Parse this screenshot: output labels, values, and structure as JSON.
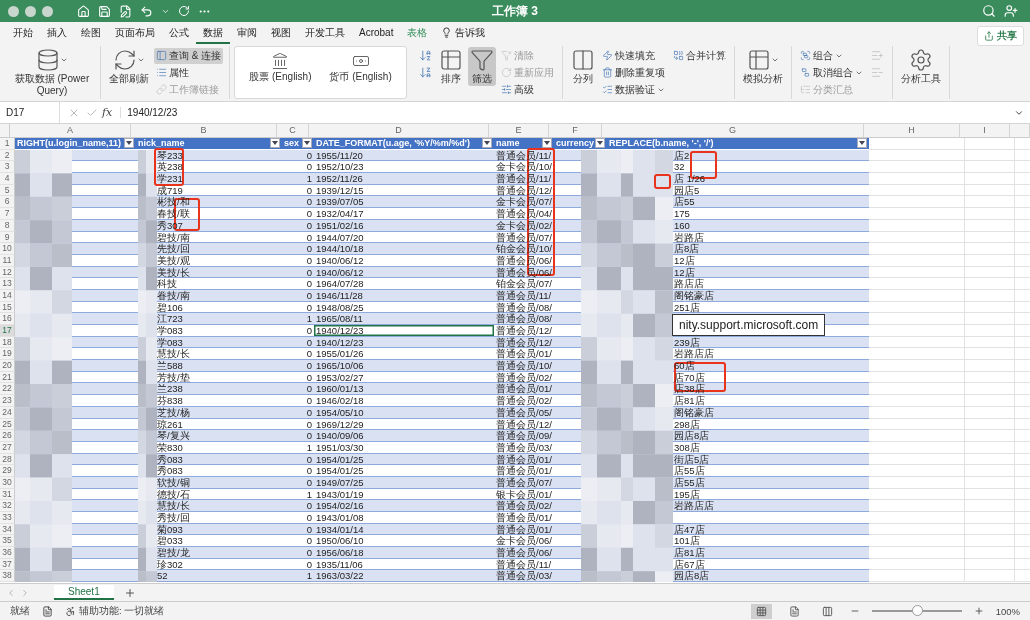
{
  "window": {
    "title": "工作簿 3"
  },
  "menu_tabs": [
    {
      "label": "开始",
      "kind": "tab",
      "selected": false
    },
    {
      "label": "插入",
      "kind": "tab",
      "selected": false
    },
    {
      "label": "绘图",
      "kind": "tab",
      "selected": false
    },
    {
      "label": "页面布局",
      "kind": "tab",
      "selected": false
    },
    {
      "label": "公式",
      "kind": "tab",
      "selected": false
    },
    {
      "label": "数据",
      "kind": "tab",
      "selected": true
    },
    {
      "label": "审阅",
      "kind": "tab",
      "selected": false
    },
    {
      "label": "视图",
      "kind": "tab",
      "selected": false
    },
    {
      "label": "开发工具",
      "kind": "tab",
      "selected": false
    },
    {
      "label": "Acrobat",
      "kind": "tab",
      "selected": false
    },
    {
      "label": "表格",
      "kind": "contextual",
      "selected": false
    },
    {
      "label": "告诉我",
      "kind": "tell-me",
      "selected": false
    }
  ],
  "share_button": "共享",
  "ribbon": [
    {
      "boxed": false,
      "items": [
        {
          "kind": "large",
          "label": "获取数据 (Power Query)",
          "menu": true,
          "active": false,
          "disabled": false
        }
      ]
    },
    {
      "boxed": false,
      "items": [
        {
          "kind": "large",
          "label": "全部刷新",
          "menu": true,
          "active": false,
          "disabled": false
        },
        {
          "kind": "small",
          "label": "查询 & 连接",
          "menu": false,
          "active": true,
          "disabled": false
        },
        {
          "kind": "small",
          "label": "属性",
          "menu": false,
          "active": false,
          "disabled": false
        },
        {
          "kind": "small",
          "label": "工作簿链接",
          "menu": false,
          "active": false,
          "disabled": true
        }
      ]
    },
    {
      "boxed": true,
      "items": [
        {
          "kind": "datatype",
          "label": "股票 (English)",
          "menu": false,
          "active": false,
          "disabled": false
        },
        {
          "kind": "datatype",
          "label": "货币 (English)",
          "menu": false,
          "active": false,
          "disabled": false
        }
      ]
    },
    {
      "boxed": false,
      "items": [
        {
          "kind": "icon",
          "disabled": false
        },
        {
          "kind": "icon",
          "disabled": false
        },
        {
          "kind": "large",
          "label": "排序",
          "menu": false,
          "active": false,
          "disabled": false
        },
        {
          "kind": "large",
          "label": "筛选",
          "menu": false,
          "active": true,
          "disabled": false
        },
        {
          "kind": "small",
          "label": "清除",
          "menu": false,
          "active": false,
          "disabled": true
        },
        {
          "kind": "small",
          "label": "重新应用",
          "menu": false,
          "active": false,
          "disabled": true
        },
        {
          "kind": "small",
          "label": "高级",
          "menu": false,
          "active": false,
          "disabled": false
        }
      ]
    },
    {
      "boxed": false,
      "items": [
        {
          "kind": "large",
          "label": "分列",
          "menu": false,
          "active": false,
          "disabled": false
        },
        {
          "kind": "small",
          "label": "快速填充",
          "menu": false,
          "active": false,
          "disabled": false
        },
        {
          "kind": "small",
          "label": "删除重复项",
          "menu": false,
          "active": false,
          "disabled": false
        },
        {
          "kind": "small",
          "label": "数据验证",
          "menu": true,
          "active": false,
          "disabled": false
        },
        {
          "kind": "small",
          "label": "合并计算",
          "menu": false,
          "active": false,
          "disabled": false
        }
      ]
    },
    {
      "boxed": false,
      "items": [
        {
          "kind": "large",
          "label": "模拟分析",
          "menu": true,
          "active": false,
          "disabled": false
        }
      ]
    },
    {
      "boxed": false,
      "items": [
        {
          "kind": "small",
          "label": "组合",
          "menu": true,
          "active": false,
          "disabled": false
        },
        {
          "kind": "small",
          "label": "取消组合",
          "menu": true,
          "active": false,
          "disabled": false
        },
        {
          "kind": "small",
          "label": "分类汇总",
          "menu": false,
          "active": false,
          "disabled": true
        },
        {
          "kind": "icon",
          "disabled": true
        },
        {
          "kind": "icon",
          "disabled": true
        }
      ]
    },
    {
      "boxed": false,
      "items": [
        {
          "kind": "large",
          "label": "分析工具",
          "menu": false,
          "active": false,
          "disabled": false
        }
      ]
    }
  ],
  "formula_bar": {
    "name_box": "D17",
    "fx": "fx",
    "formula": "1940/12/23"
  },
  "column_letters": [
    "A",
    "B",
    "C",
    "D",
    "E",
    "F",
    "G",
    "H",
    "I"
  ],
  "table": {
    "header_row_number": "1",
    "columns": [
      "RIGHT(u.login_name,11)",
      "nick_name",
      "sex",
      "DATE_FORMAT(u.age, '%Y/%m/%d')",
      "name",
      "currency",
      "REPLACE(b.name, '-', '/')"
    ],
    "rows": [
      {
        "n": "2",
        "nick": "琴233",
        "sex": "0",
        "date": "1955/11/20",
        "name": "普通会员/11/",
        "g": "店2",
        "selected": false
      },
      {
        "n": "3",
        "nick": "英238",
        "sex": "0",
        "date": "1952/10/23",
        "name": "金卡会员/10/",
        "g": "32",
        "selected": false
      },
      {
        "n": "4",
        "nick": "学231",
        "sex": "1",
        "date": "1952/11/26",
        "name": "普通会员/11/",
        "g": "店 1/26",
        "selected": false
      },
      {
        "n": "5",
        "nick": "成719",
        "sex": "0",
        "date": "1939/12/15",
        "name": "普通会员/12/",
        "g": "园店5",
        "selected": false
      },
      {
        "n": "6",
        "nick": "彬技/和",
        "sex": "0",
        "date": "1939/07/05",
        "name": "金卡会员/07/",
        "g": "店55",
        "selected": false
      },
      {
        "n": "7",
        "nick": "春技/联",
        "sex": "0",
        "date": "1932/04/17",
        "name": "普通会员/04/",
        "g": "175",
        "selected": false
      },
      {
        "n": "8",
        "nick": "秀307",
        "sex": "0",
        "date": "1951/02/16",
        "name": "金卡会员/02/",
        "g": "160",
        "selected": false
      },
      {
        "n": "9",
        "nick": "碧技/南",
        "sex": "0",
        "date": "1944/07/20",
        "name": "普通会员/07/",
        "g": "岩路店",
        "selected": false
      },
      {
        "n": "10",
        "nick": "先技/回",
        "sex": "0",
        "date": "1944/10/18",
        "name": "铂金会员/10/",
        "g": "店8店",
        "selected": false
      },
      {
        "n": "11",
        "nick": "美技/观",
        "sex": "0",
        "date": "1940/06/12",
        "name": "普通会员/06/",
        "g": "12店",
        "selected": false
      },
      {
        "n": "12",
        "nick": "美技/长",
        "sex": "0",
        "date": "1940/06/12",
        "name": "普通会员/06/",
        "g": "12店",
        "selected": false
      },
      {
        "n": "13",
        "nick": "科技",
        "sex": "0",
        "date": "1964/07/28",
        "name": "铂金会员/07/",
        "g": "路店店",
        "selected": false
      },
      {
        "n": "14",
        "nick": "眷技/南",
        "sex": "0",
        "date": "1946/11/28",
        "name": "普通会员/11/",
        "g": "阁铭豪店",
        "selected": false
      },
      {
        "n": "15",
        "nick": "碧106",
        "sex": "0",
        "date": "1948/08/25",
        "name": "普通会员/08/",
        "g": "251店",
        "selected": false
      },
      {
        "n": "16",
        "nick": "江723",
        "sex": "1",
        "date": "1965/08/11",
        "name": "普通会员/08/",
        "selected": false
      },
      {
        "n": "17",
        "nick": "学083",
        "sex": "0",
        "date": "1940/12/23",
        "name": "普通会员/12/",
        "selected": true
      },
      {
        "n": "18",
        "nick": "学083",
        "sex": "0",
        "date": "1940/12/23",
        "name": "普通会员/12/",
        "g": "239店",
        "selected": false
      },
      {
        "n": "19",
        "nick": "慧技/长",
        "sex": "0",
        "date": "1955/01/26",
        "name": "普通会员/01/",
        "g": "岩路店店",
        "selected": false
      },
      {
        "n": "20",
        "nick": "兰588",
        "sex": "0",
        "date": "1965/10/06",
        "name": "普通会员/10/",
        "g": "60店",
        "selected": false
      },
      {
        "n": "21",
        "nick": "芳技/垫",
        "sex": "0",
        "date": "1953/02/27",
        "name": "普通会员/02/",
        "g": "店70店",
        "selected": false
      },
      {
        "n": "22",
        "nick": "兰238",
        "sex": "0",
        "date": "1960/01/13",
        "name": "普通会员/01/",
        "g": "店38店",
        "selected": false
      },
      {
        "n": "23",
        "nick": "芬838",
        "sex": "0",
        "date": "1946/02/18",
        "name": "普通会员/02/",
        "g": "店81店",
        "selected": false
      },
      {
        "n": "24",
        "nick": "芝技/杨",
        "sex": "0",
        "date": "1954/05/10",
        "name": "普通会员/05/",
        "g": "阁铭豪店",
        "selected": false
      },
      {
        "n": "25",
        "nick": "琼261",
        "sex": "0",
        "date": "1969/12/29",
        "name": "普通会员/12/",
        "g": "298店",
        "selected": false
      },
      {
        "n": "26",
        "nick": "琴/复兴",
        "sex": "0",
        "date": "1940/09/06",
        "name": "普通会员/09/",
        "g": "园店8店",
        "selected": false
      },
      {
        "n": "27",
        "nick": "荣830",
        "sex": "1",
        "date": "1951/03/30",
        "name": "普通会员/03/",
        "g": "308店",
        "selected": false
      },
      {
        "n": "28",
        "nick": "秀083",
        "sex": "0",
        "date": "1954/01/25",
        "name": "普通会员/01/",
        "g": "街店5店",
        "selected": false
      },
      {
        "n": "29",
        "nick": "秀083",
        "sex": "0",
        "date": "1954/01/25",
        "name": "普通会员/01/",
        "g": "店55店",
        "selected": false
      },
      {
        "n": "30",
        "nick": "软技/铜",
        "sex": "0",
        "date": "1949/07/25",
        "name": "普通会员/07/",
        "g": "店55店",
        "selected": false
      },
      {
        "n": "31",
        "nick": "德技/石",
        "sex": "1",
        "date": "1943/01/19",
        "name": "银卡会员/01/",
        "g": "195店",
        "selected": false
      },
      {
        "n": "32",
        "nick": "慧技/长",
        "sex": "0",
        "date": "1954/02/16",
        "name": "普通会员/02/",
        "g": "岩路店店",
        "selected": false
      },
      {
        "n": "33",
        "nick": "秀技/回",
        "sex": "0",
        "date": "1943/01/08",
        "name": "普通会员/01/",
        "selected": false
      },
      {
        "n": "34",
        "nick": "菊093",
        "sex": "0",
        "date": "1934/01/14",
        "name": "普通会员/01/",
        "g": "店47店",
        "selected": false
      },
      {
        "n": "35",
        "nick": "碧033",
        "sex": "0",
        "date": "1950/06/10",
        "name": "金卡会员/06/",
        "g": "101店",
        "selected": false
      },
      {
        "n": "36",
        "nick": "碧技/龙",
        "sex": "0",
        "date": "1956/06/18",
        "name": "普通会员/06/",
        "g": "店81店",
        "selected": false
      },
      {
        "n": "37",
        "nick": "珍302",
        "sex": "0",
        "date": "1935/11/06",
        "name": "普通会员/11/",
        "g": "店67店",
        "selected": false
      },
      {
        "n": "38",
        "nick": "52",
        "sex": "1",
        "date": "1963/03/22",
        "name": "普通会员/03/",
        "g": "园店8店",
        "selected": false
      }
    ]
  },
  "tooltip": "nity.support.microsoft.com",
  "sheet_tabs": [
    {
      "label": "Sheet1",
      "selected": true
    }
  ],
  "status_bar": {
    "status": "就绪",
    "accessibility": "辅助功能: 一切就绪",
    "views": [
      {
        "selected": true
      },
      {
        "selected": false
      },
      {
        "selected": false
      }
    ],
    "zoom": {
      "level": 0.5,
      "reading": "100%"
    }
  }
}
